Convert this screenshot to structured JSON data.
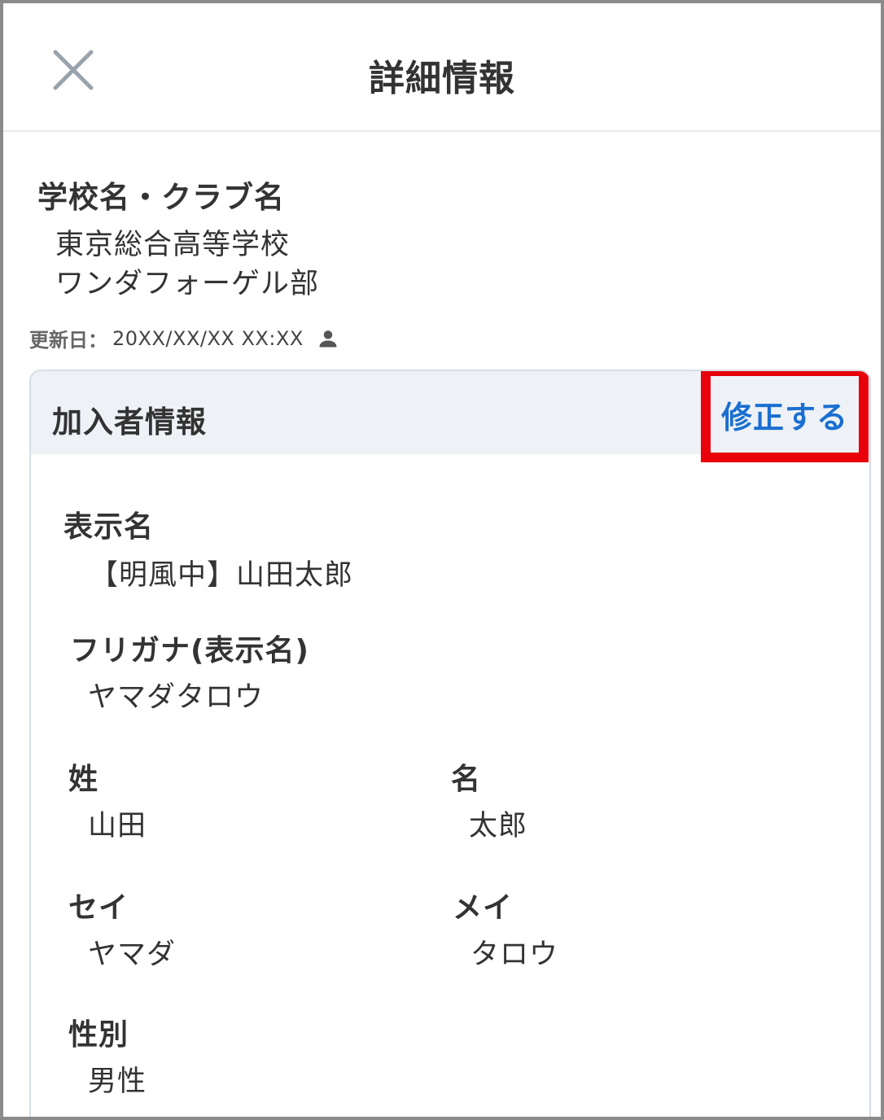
{
  "header": {
    "title": "詳細情報",
    "close_icon": "close-icon"
  },
  "school": {
    "label": "学校名・クラブ名",
    "name_line1": "東京総合高等学校",
    "name_line2": "ワンダフォーゲル部"
  },
  "updated": {
    "label": "更新日：",
    "value": "20XX/XX/XX  XX:XX",
    "icon": "person-icon"
  },
  "member_card": {
    "title": "加入者情報",
    "edit_label": "修正する",
    "edit_highlight_color": "#e8000b",
    "edit_text_color": "#1a6fd1",
    "fields": {
      "display_name": {
        "label": "表示名",
        "value": "【明風中】山田太郎"
      },
      "display_name_kana": {
        "label": "フリガナ(表示名)",
        "value": "ヤマダタロウ"
      },
      "last_name": {
        "label": "姓",
        "value": "山田"
      },
      "first_name": {
        "label": "名",
        "value": "太郎"
      },
      "last_name_kana": {
        "label": "セイ",
        "value": "ヤマダ"
      },
      "first_name_kana": {
        "label": "メイ",
        "value": "タロウ"
      },
      "gender": {
        "label": "性別",
        "value": "男性"
      }
    }
  }
}
